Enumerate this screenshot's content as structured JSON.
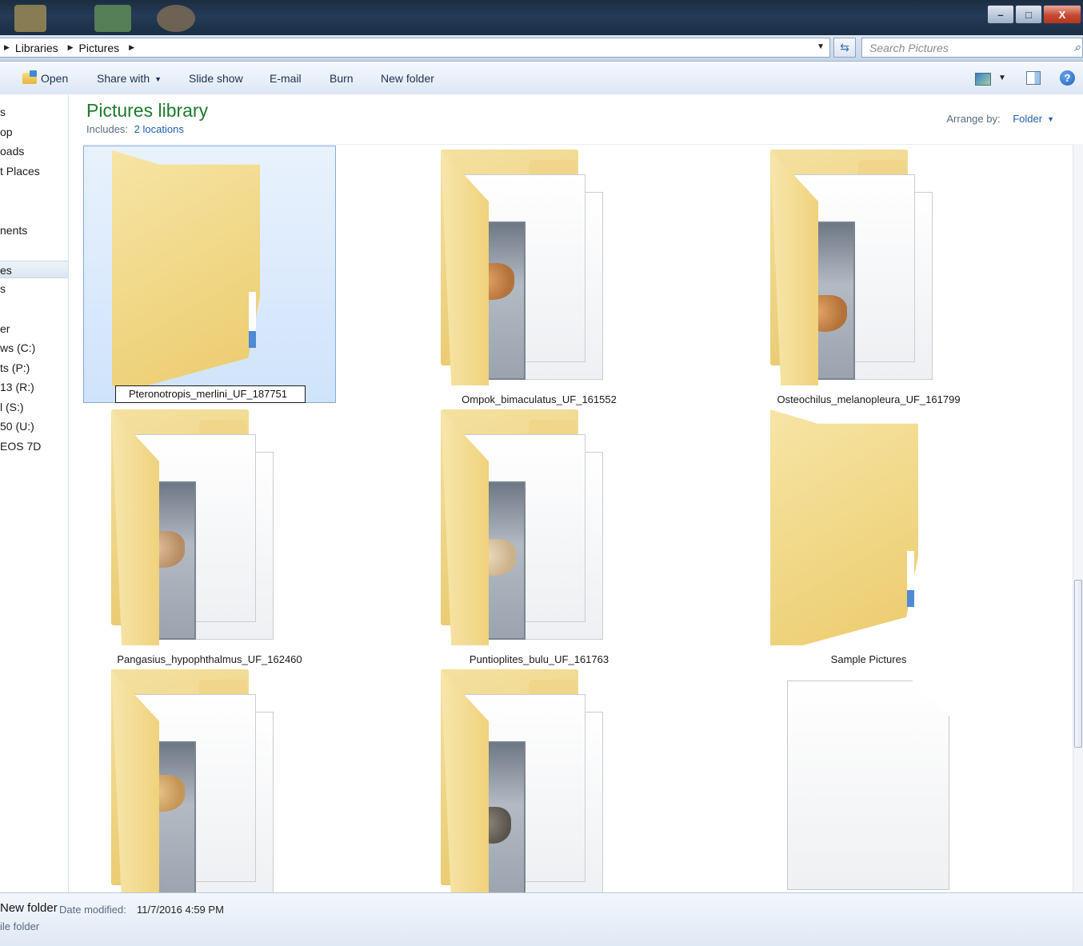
{
  "titlebar": {
    "minimize": "–",
    "maximize": "□",
    "close": "X"
  },
  "address": {
    "crumbs": [
      "Libraries",
      "Pictures"
    ],
    "search_placeholder": "Search Pictures"
  },
  "toolbar": {
    "open": "Open",
    "share_with": "Share with",
    "slide_show": "Slide show",
    "email": "E-mail",
    "burn": "Burn",
    "new_folder": "New folder"
  },
  "nav": {
    "items": [
      "s",
      "op",
      "oads",
      "t Places",
      "nents",
      "es",
      "s",
      "er",
      "ws (C:)",
      "ts (P:)",
      "13 (R:)",
      "l (S:)",
      "50 (U:)",
      " EOS 7D",
      ""
    ]
  },
  "library": {
    "title": "Pictures library",
    "includes_label": "Includes:",
    "includes_link": "2 locations",
    "arrange_label": "Arrange by:",
    "arrange_value": "Folder"
  },
  "folders": [
    {
      "name": "Pteronotropis_merlini_UF_187751",
      "renaming": true
    },
    {
      "name": "Ompok_bimaculatus_UF_161552"
    },
    {
      "name": "Osteochilus_melanopleura_UF_161799"
    },
    {
      "name": "Pangasius_hypophthalmus_UF_162460"
    },
    {
      "name": "Puntioplites_bulu_UF_161763"
    },
    {
      "name": "Sample Pictures"
    }
  ],
  "details": {
    "name": "New folder",
    "date_label": "Date modified:",
    "date_value": "11/7/2016 4:59 PM",
    "type": "ile folder"
  }
}
